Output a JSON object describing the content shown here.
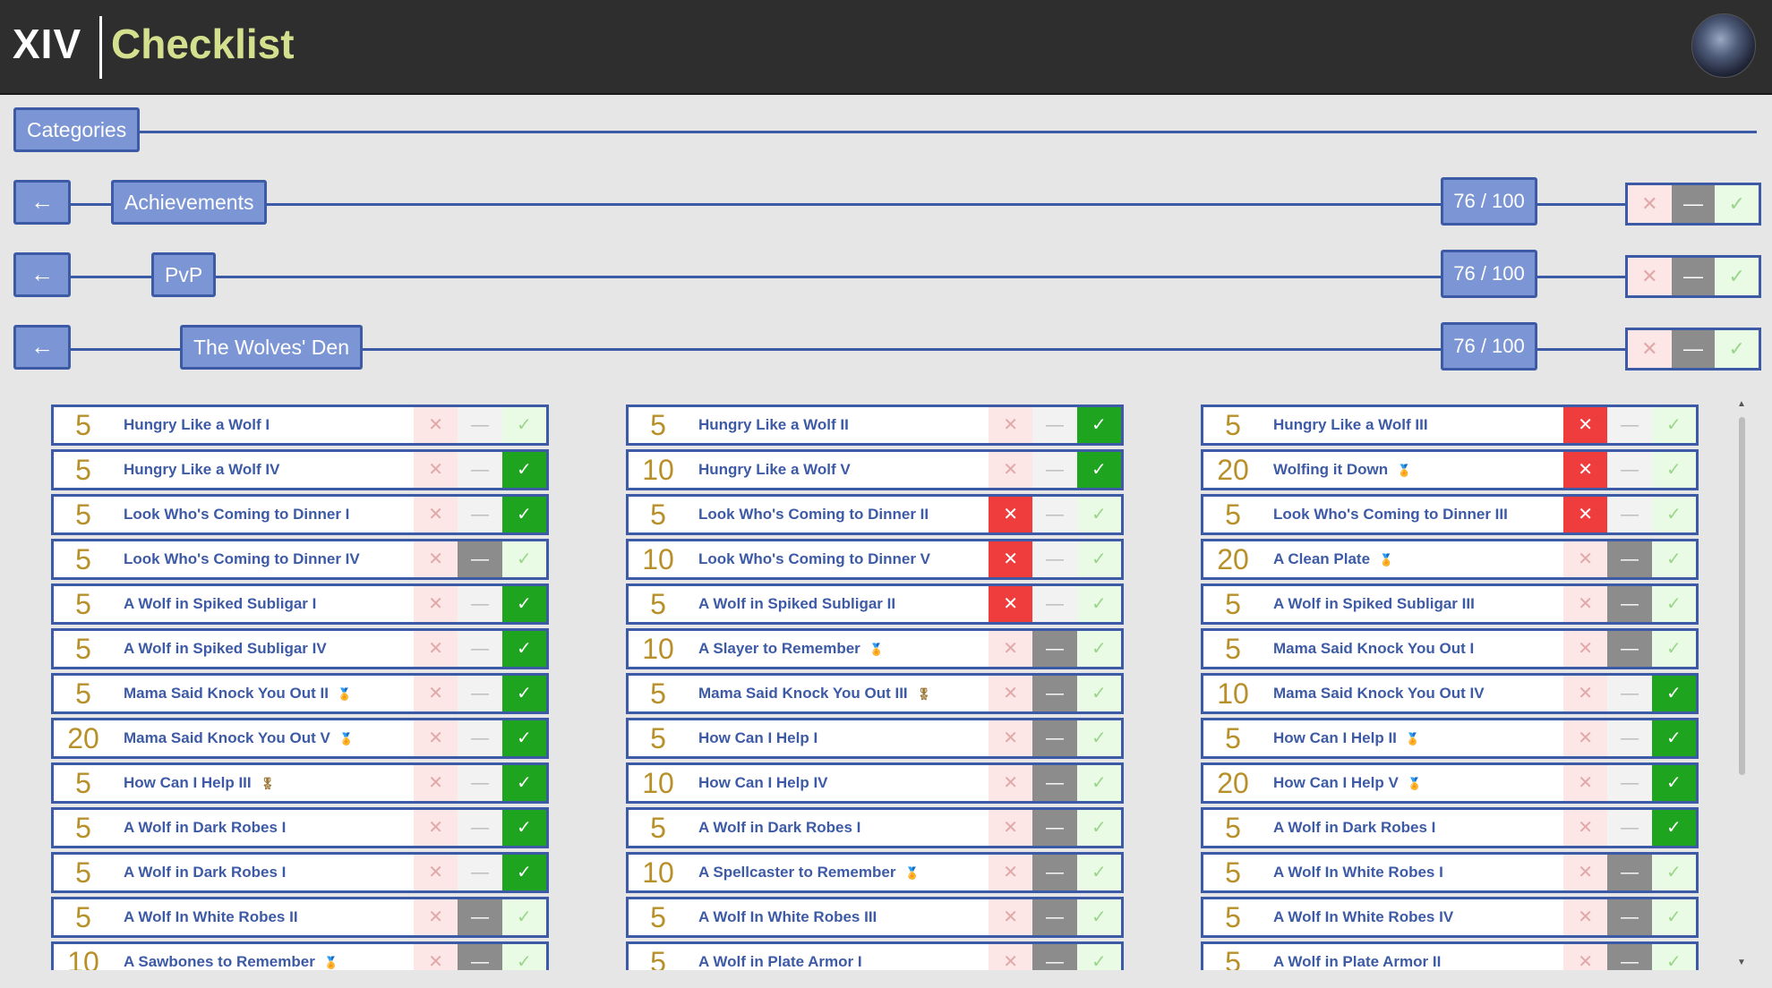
{
  "header": {
    "logo": "XIV",
    "title": "Checklist"
  },
  "breadcrumbs": {
    "categories": "Categories",
    "back_icon": "←",
    "achievements": "Achievements",
    "pvp": "PvP",
    "wolves_den": "The Wolves' Den",
    "count": "76 / 100"
  },
  "state_icons": {
    "x": "✕",
    "dash": "—",
    "ok": "✓"
  },
  "columns": [
    [
      {
        "pts": "5",
        "name": "Hungry Like a Wolf I",
        "medal": "",
        "state": "none"
      },
      {
        "pts": "5",
        "name": "Hungry Like a Wolf IV",
        "medal": "",
        "state": "ok"
      },
      {
        "pts": "5",
        "name": "Look Who's Coming to Dinner I",
        "medal": "",
        "state": "ok"
      },
      {
        "pts": "5",
        "name": "Look Who's Coming to Dinner IV",
        "medal": "",
        "state": "dash"
      },
      {
        "pts": "5",
        "name": "A Wolf in Spiked Subligar I",
        "medal": "",
        "state": "ok"
      },
      {
        "pts": "5",
        "name": "A Wolf in Spiked Subligar IV",
        "medal": "",
        "state": "ok"
      },
      {
        "pts": "5",
        "name": "Mama Said Knock You Out II",
        "medal": "🏅",
        "state": "ok"
      },
      {
        "pts": "20",
        "name": "Mama Said Knock You Out V",
        "medal": "🏅",
        "state": "ok"
      },
      {
        "pts": "5",
        "name": "How Can I Help III",
        "medal": "🎖",
        "state": "ok"
      },
      {
        "pts": "5",
        "name": "A Wolf in Dark Robes I",
        "medal": "",
        "state": "ok"
      },
      {
        "pts": "5",
        "name": "A Wolf in Dark Robes I",
        "medal": "",
        "state": "ok"
      },
      {
        "pts": "5",
        "name": "A Wolf In White Robes II",
        "medal": "",
        "state": "dash"
      },
      {
        "pts": "10",
        "name": "A Sawbones to Remember",
        "medal": "🏅",
        "state": "dash"
      }
    ],
    [
      {
        "pts": "5",
        "name": "Hungry Like a Wolf II",
        "medal": "",
        "state": "ok"
      },
      {
        "pts": "10",
        "name": "Hungry Like a Wolf V",
        "medal": "",
        "state": "ok"
      },
      {
        "pts": "5",
        "name": "Look Who's Coming to Dinner II",
        "medal": "",
        "state": "x"
      },
      {
        "pts": "10",
        "name": "Look Who's Coming to Dinner V",
        "medal": "",
        "state": "x"
      },
      {
        "pts": "5",
        "name": "A Wolf in Spiked Subligar II",
        "medal": "",
        "state": "x"
      },
      {
        "pts": "10",
        "name": "A Slayer to Remember",
        "medal": "🏅",
        "state": "dash"
      },
      {
        "pts": "5",
        "name": "Mama Said Knock You Out III",
        "medal": "🎖",
        "state": "dash"
      },
      {
        "pts": "5",
        "name": "How Can I Help I",
        "medal": "",
        "state": "dash"
      },
      {
        "pts": "10",
        "name": "How Can I Help IV",
        "medal": "",
        "state": "dash"
      },
      {
        "pts": "5",
        "name": "A Wolf in Dark Robes I",
        "medal": "",
        "state": "dash"
      },
      {
        "pts": "10",
        "name": "A Spellcaster to Remember",
        "medal": "🏅",
        "state": "dash"
      },
      {
        "pts": "5",
        "name": "A Wolf In White Robes III",
        "medal": "",
        "state": "dash"
      },
      {
        "pts": "5",
        "name": "A Wolf in Plate Armor I",
        "medal": "",
        "state": "dash"
      }
    ],
    [
      {
        "pts": "5",
        "name": "Hungry Like a Wolf III",
        "medal": "",
        "state": "x"
      },
      {
        "pts": "20",
        "name": "Wolfing it Down",
        "medal": "🏅",
        "state": "x"
      },
      {
        "pts": "5",
        "name": "Look Who's Coming to Dinner III",
        "medal": "",
        "state": "x"
      },
      {
        "pts": "20",
        "name": "A Clean Plate",
        "medal": "🏅",
        "state": "dash"
      },
      {
        "pts": "5",
        "name": "A Wolf in Spiked Subligar III",
        "medal": "",
        "state": "dash"
      },
      {
        "pts": "5",
        "name": "Mama Said Knock You Out I",
        "medal": "",
        "state": "dash"
      },
      {
        "pts": "10",
        "name": "Mama Said Knock You Out IV",
        "medal": "",
        "state": "ok"
      },
      {
        "pts": "5",
        "name": "How Can I Help II",
        "medal": "🏅",
        "state": "ok"
      },
      {
        "pts": "20",
        "name": "How Can I Help V",
        "medal": "🏅",
        "state": "ok"
      },
      {
        "pts": "5",
        "name": "A Wolf in Dark Robes I",
        "medal": "",
        "state": "ok"
      },
      {
        "pts": "5",
        "name": "A Wolf In White Robes I",
        "medal": "",
        "state": "dash"
      },
      {
        "pts": "5",
        "name": "A Wolf In White Robes IV",
        "medal": "",
        "state": "dash"
      },
      {
        "pts": "5",
        "name": "A Wolf in Plate Armor II",
        "medal": "",
        "state": "dash"
      }
    ]
  ]
}
